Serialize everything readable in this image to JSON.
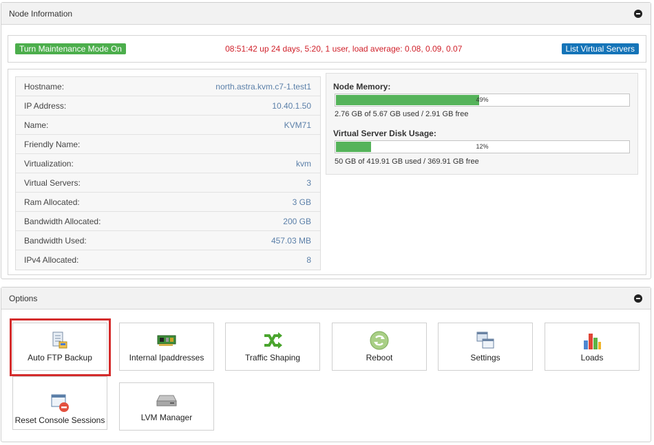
{
  "node_panel": {
    "title": "Node Information",
    "maintenance_button": "Turn Maintenance Mode On",
    "uptime": "08:51:42 up 24 days, 5:20, 1 user, load average: 0.08, 0.09, 0.07",
    "list_servers_button": "List Virtual Servers",
    "info_rows": [
      {
        "label": "Hostname:",
        "value": "north.astra.kvm.c7-1.test1"
      },
      {
        "label": "IP Address:",
        "value": "10.40.1.50"
      },
      {
        "label": "Name:",
        "value": "KVM71"
      },
      {
        "label": "Friendly Name:",
        "value": ""
      },
      {
        "label": "Virtualization:",
        "value": "kvm"
      },
      {
        "label": "Virtual Servers:",
        "value": "3"
      },
      {
        "label": "Ram Allocated:",
        "value": "3 GB"
      },
      {
        "label": "Bandwidth Allocated:",
        "value": "200 GB"
      },
      {
        "label": "Bandwidth Used:",
        "value": "457.03 MB"
      },
      {
        "label": "IPv4 Allocated:",
        "value": "8"
      }
    ],
    "memory": {
      "title": "Node Memory:",
      "percent_label": "49%",
      "percent": 49,
      "note": "2.76 GB of 5.67 GB used / 2.91 GB free"
    },
    "disk": {
      "title": "Virtual Server Disk Usage:",
      "percent_label": "12%",
      "percent": 12,
      "note": "50 GB of 419.91 GB used / 369.91 GB free"
    }
  },
  "options_panel": {
    "title": "Options",
    "tiles": [
      {
        "label": "Auto FTP Backup",
        "icon": "ftp-backup-icon"
      },
      {
        "label": "Internal Ipaddresses",
        "icon": "network-card-icon"
      },
      {
        "label": "Traffic Shaping",
        "icon": "shuffle-arrows-icon"
      },
      {
        "label": "Reboot",
        "icon": "reboot-icon"
      },
      {
        "label": "Settings",
        "icon": "settings-windows-icon"
      },
      {
        "label": "Loads",
        "icon": "bar-chart-icon"
      },
      {
        "label": "Reset Console Sessions",
        "icon": "console-reset-icon"
      },
      {
        "label": "LVM Manager",
        "icon": "disk-drive-icon"
      }
    ]
  },
  "colors": {
    "green": "#4cae4c",
    "blue": "#1574b8",
    "red_text": "#d0202a",
    "highlight": "#d42b2b"
  }
}
